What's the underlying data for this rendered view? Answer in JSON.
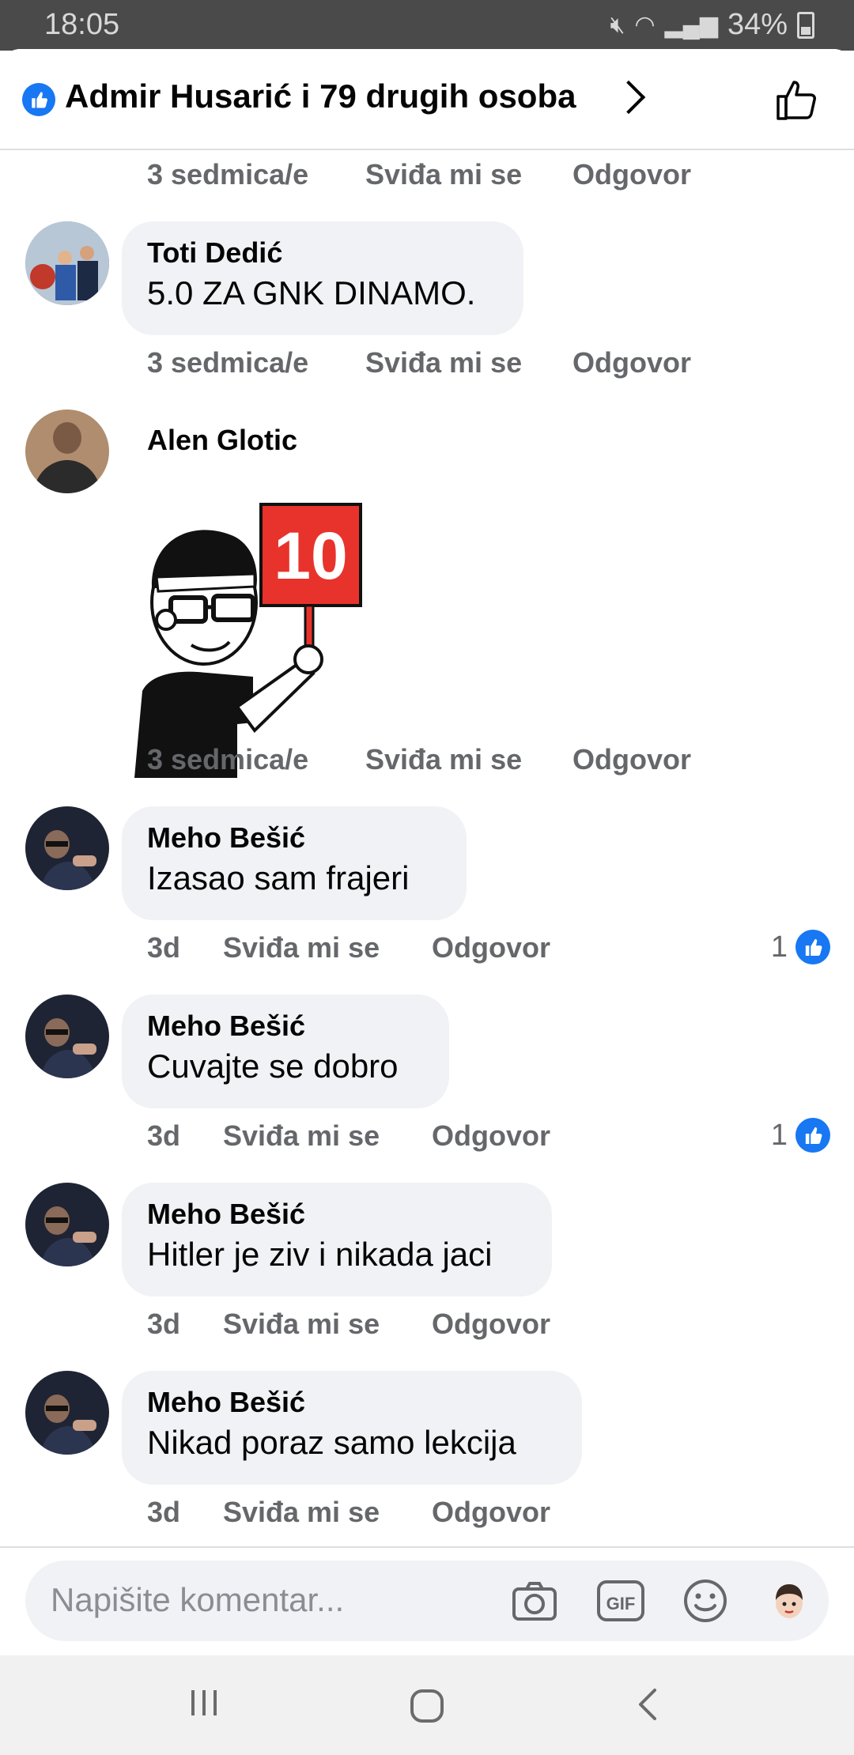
{
  "status_bar": {
    "time": "18:05",
    "battery": "34%"
  },
  "header": {
    "title": "Admir Husarić i 79 drugih osoba"
  },
  "comments": [
    {
      "name": "",
      "text": "",
      "time": "3 sedmica/e",
      "like": "Sviđa mi se",
      "reply": "Odgovor"
    },
    {
      "name": "Toti Dedić",
      "text": "5.0 ZA GNK DINAMO.",
      "time": "3 sedmica/e",
      "like": "Sviđa mi se",
      "reply": "Odgovor"
    },
    {
      "name": "Alen Glotic",
      "sticker_text": "10",
      "time": "3 sedmica/e",
      "like": "Sviđa mi se",
      "reply": "Odgovor"
    },
    {
      "name": "Meho Bešić",
      "text": "Izasao sam frajeri",
      "time": "3d",
      "like": "Sviđa mi se",
      "reply": "Odgovor",
      "reactions": "1"
    },
    {
      "name": "Meho Bešić",
      "text": "Cuvajte se dobro",
      "time": "3d",
      "like": "Sviđa mi se",
      "reply": "Odgovor",
      "reactions": "1"
    },
    {
      "name": "Meho Bešić",
      "text": "Hitler je ziv i nikada jaci",
      "time": "3d",
      "like": "Sviđa mi se",
      "reply": "Odgovor"
    },
    {
      "name": "Meho Bešić",
      "text": "Nikad poraz samo lekcija",
      "time": "3d",
      "like": "Sviđa mi se",
      "reply": "Odgovor"
    }
  ],
  "composer": {
    "placeholder": "Napišite komentar...",
    "gif_label": "GIF"
  },
  "colors": {
    "accent": "#1877f2",
    "bubble": "#f0f2f5",
    "meta_text": "#65676b"
  }
}
